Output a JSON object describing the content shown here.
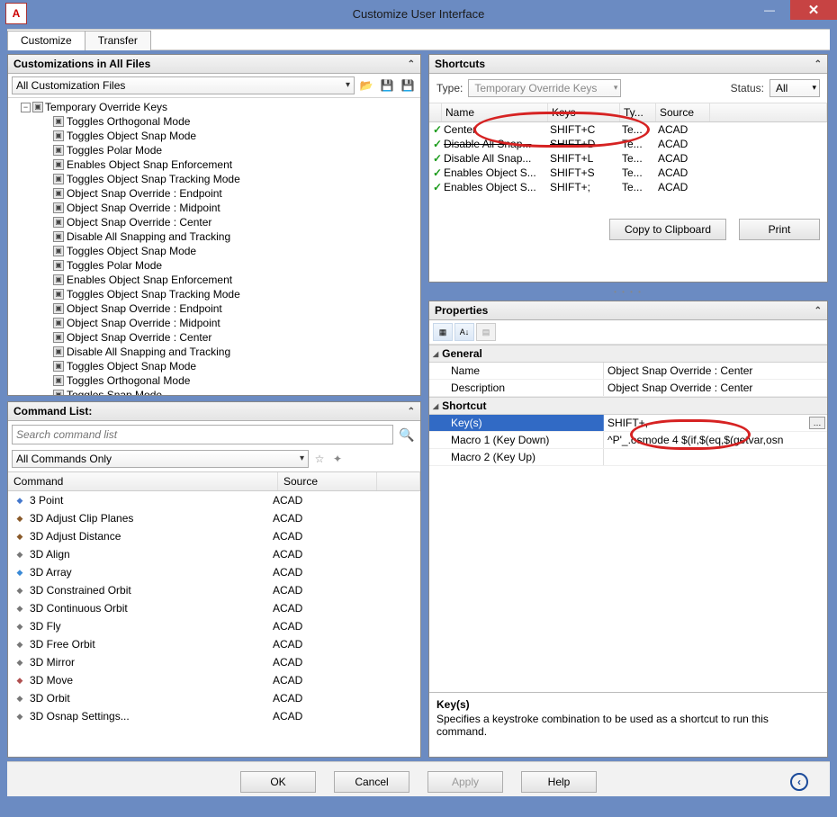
{
  "window": {
    "title": "Customize User Interface",
    "app_icon_glyph": "A"
  },
  "tabs": {
    "customize": "Customize",
    "transfer": "Transfer"
  },
  "left": {
    "customizations_panel": {
      "title": "Customizations in All Files",
      "filter": "All Customization Files",
      "tree_root": "Temporary Override Keys",
      "tree_items": [
        "Toggles Orthogonal Mode",
        "Toggles Object Snap Mode",
        "Toggles Polar Mode",
        "Enables Object Snap Enforcement",
        "Toggles Object Snap Tracking Mode",
        "Object Snap Override : Endpoint",
        "Object Snap Override : Midpoint",
        "Object Snap Override : Center",
        "Disable All Snapping and Tracking",
        "Toggles Object Snap Mode",
        "Toggles Polar Mode",
        "Enables Object Snap Enforcement",
        "Toggles Object Snap Tracking Mode",
        "Object Snap Override : Endpoint",
        "Object Snap Override : Midpoint",
        "Object Snap Override : Center",
        "Disable All Snapping and Tracking",
        "Toggles Object Snap Mode",
        "Toggles Orthogonal Mode",
        "Toggles Snap Mode"
      ]
    },
    "command_list_panel": {
      "title": "Command List:",
      "search_placeholder": "Search command list",
      "filter": "All Commands Only",
      "columns": {
        "command": "Command",
        "source": "Source"
      },
      "commands": [
        {
          "name": "3 Point",
          "source": "ACAD",
          "color": "#4477cc"
        },
        {
          "name": "3D Adjust Clip Planes",
          "source": "ACAD",
          "color": "#8a5a2a"
        },
        {
          "name": "3D Adjust Distance",
          "source": "ACAD",
          "color": "#8a5a2a"
        },
        {
          "name": "3D Align",
          "source": "ACAD",
          "color": "#777"
        },
        {
          "name": "3D Array",
          "source": "ACAD",
          "color": "#3a8ad6"
        },
        {
          "name": "3D Constrained Orbit",
          "source": "ACAD",
          "color": "#777"
        },
        {
          "name": "3D Continuous Orbit",
          "source": "ACAD",
          "color": "#777"
        },
        {
          "name": "3D Fly",
          "source": "ACAD",
          "color": "#777"
        },
        {
          "name": "3D Free Orbit",
          "source": "ACAD",
          "color": "#777"
        },
        {
          "name": "3D Mirror",
          "source": "ACAD",
          "color": "#777"
        },
        {
          "name": "3D Move",
          "source": "ACAD",
          "color": "#b05050"
        },
        {
          "name": "3D Orbit",
          "source": "ACAD",
          "color": "#777"
        },
        {
          "name": "3D Osnap Settings...",
          "source": "ACAD",
          "color": "#777"
        }
      ]
    }
  },
  "right": {
    "shortcuts_panel": {
      "title": "Shortcuts",
      "type_label": "Type:",
      "type_value": "Temporary Override Keys",
      "status_label": "Status:",
      "status_value": "All",
      "columns": {
        "name": "Name",
        "keys": "Keys",
        "type": "Ty...",
        "source": "Source"
      },
      "rows": [
        {
          "name": "Center",
          "keys": "SHIFT+C",
          "type": "Te...",
          "source": "ACAD",
          "strike": false
        },
        {
          "name": "Disable All Snap...",
          "keys": "SHIFT+D",
          "type": "Te...",
          "source": "ACAD",
          "strike": true
        },
        {
          "name": "Disable All Snap...",
          "keys": "SHIFT+L",
          "type": "Te...",
          "source": "ACAD",
          "strike": false
        },
        {
          "name": "Enables Object S...",
          "keys": "SHIFT+S",
          "type": "Te...",
          "source": "ACAD",
          "strike": false
        },
        {
          "name": "Enables Object S...",
          "keys": "SHIFT+;",
          "type": "Te...",
          "source": "ACAD",
          "strike": false
        }
      ],
      "copy_btn": "Copy to Clipboard",
      "print_btn": "Print"
    },
    "properties_panel": {
      "title": "Properties",
      "categories": {
        "general": {
          "label": "General",
          "rows": [
            {
              "label": "Name",
              "value": "Object Snap Override : Center"
            },
            {
              "label": "Description",
              "value": "Object Snap Override : Center"
            }
          ]
        },
        "shortcut": {
          "label": "Shortcut",
          "rows": [
            {
              "label": "Key(s)",
              "value": "SHIFT+,",
              "selected": true
            },
            {
              "label": "Macro 1 (Key Down)",
              "value": "^P'_.osmode 4 $(if,$(eq,$(getvar,osn"
            },
            {
              "label": "Macro 2 (Key Up)",
              "value": ""
            }
          ]
        }
      },
      "help_title": "Key(s)",
      "help_text": "Specifies a keystroke combination to be used as a shortcut to run this command."
    }
  },
  "bottom": {
    "ok": "OK",
    "cancel": "Cancel",
    "apply": "Apply",
    "help": "Help"
  }
}
